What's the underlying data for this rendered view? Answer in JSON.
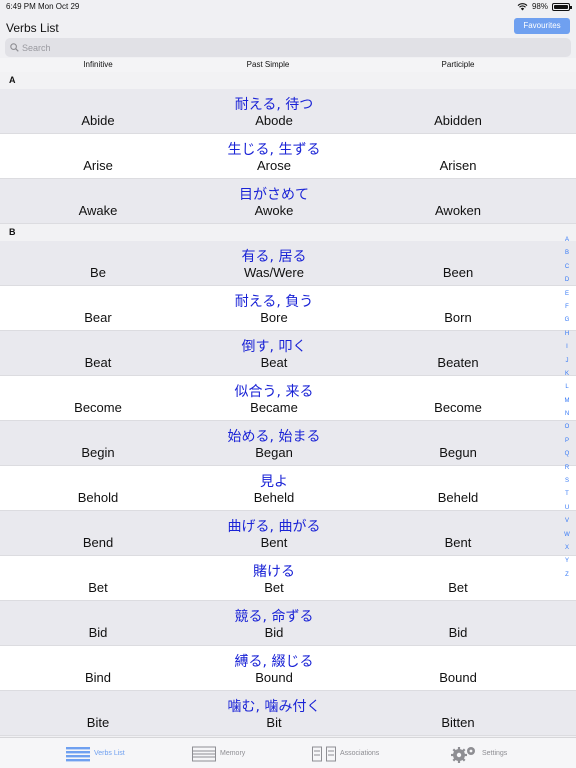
{
  "status": {
    "time": "6:49 PM",
    "date": "Mon Oct 29",
    "battery": "98%",
    "battery_level": 0.98
  },
  "nav": {
    "title": "Verbs List",
    "favourites_label": "Favourites"
  },
  "search": {
    "placeholder": "Search"
  },
  "columns": {
    "infinitive": "Infinitive",
    "past_simple": "Past Simple",
    "participle": "Participle"
  },
  "sections": [
    {
      "letter": "A",
      "rows": [
        {
          "jp": "耐える, 待つ",
          "infinitive": "Abide",
          "past": "Abode",
          "participle": "Abidden"
        },
        {
          "jp": "生じる, 生ずる",
          "infinitive": "Arise",
          "past": "Arose",
          "participle": "Arisen"
        },
        {
          "jp": "目がさめて",
          "infinitive": "Awake",
          "past": "Awoke",
          "participle": "Awoken"
        }
      ]
    },
    {
      "letter": "B",
      "rows": [
        {
          "jp": "有る, 居る",
          "infinitive": "Be",
          "past": "Was/Were",
          "participle": "Been"
        },
        {
          "jp": "耐える, 負う",
          "infinitive": "Bear",
          "past": "Bore",
          "participle": "Born"
        },
        {
          "jp": "倒す, 叩く",
          "infinitive": "Beat",
          "past": "Beat",
          "participle": "Beaten"
        },
        {
          "jp": "似合う, 来る",
          "infinitive": "Become",
          "past": "Became",
          "participle": "Become"
        },
        {
          "jp": "始める, 始まる",
          "infinitive": "Begin",
          "past": "Began",
          "participle": "Begun"
        },
        {
          "jp": "見よ",
          "infinitive": "Behold",
          "past": "Beheld",
          "participle": "Beheld"
        },
        {
          "jp": "曲げる, 曲がる",
          "infinitive": "Bend",
          "past": "Bent",
          "participle": "Bent"
        },
        {
          "jp": "賭ける",
          "infinitive": "Bet",
          "past": "Bet",
          "participle": "Bet"
        },
        {
          "jp": "競る, 命ずる",
          "infinitive": "Bid",
          "past": "Bid",
          "participle": "Bid"
        },
        {
          "jp": "縛る, 綴じる",
          "infinitive": "Bind",
          "past": "Bound",
          "participle": "Bound"
        },
        {
          "jp": "噛む, 噛み付く",
          "infinitive": "Bite",
          "past": "Bit",
          "participle": "Bitten"
        }
      ]
    }
  ],
  "index": [
    "A",
    "B",
    "C",
    "D",
    "E",
    "F",
    "G",
    "H",
    "I",
    "J",
    "K",
    "L",
    "M",
    "N",
    "O",
    "P",
    "Q",
    "R",
    "S",
    "T",
    "U",
    "V",
    "W",
    "X",
    "Y",
    "Z"
  ],
  "tabs": [
    {
      "label": "Verbs List",
      "icon": "list-icon",
      "active": true
    },
    {
      "label": "Memory",
      "icon": "cards-icon",
      "active": false
    },
    {
      "label": "Associations",
      "icon": "associations-icon",
      "active": false
    },
    {
      "label": "Settings",
      "icon": "gear-icon",
      "active": false
    }
  ],
  "colors": {
    "accent": "#6fa0f0",
    "japanese_text": "#1a23d6",
    "index_letters": "#3478f6"
  }
}
